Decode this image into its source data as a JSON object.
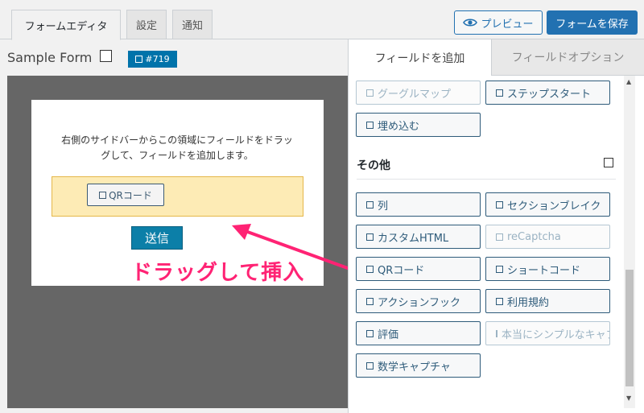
{
  "tabs": [
    {
      "label": "フォームエディタ"
    },
    {
      "label": "設定"
    },
    {
      "label": "通知"
    }
  ],
  "header": {
    "preview_label": "プレビュー",
    "save_label": "フォームを保存"
  },
  "form": {
    "title": "Sample Form",
    "id_badge": "#719"
  },
  "canvas": {
    "instruction_line1": "右側のサイドバーからこの領域にフィールドをドラッ",
    "instruction_line2": "グして、フィールドを追加します。",
    "dropped_field": "QRコード",
    "submit_label": "送信"
  },
  "annotation": {
    "text": "ドラッグして挿入",
    "color": "#ff2374"
  },
  "sidebar": {
    "tab_add": "フィールドを追加",
    "tab_options": "フィールドオプション",
    "top_fields": [
      {
        "label": "グーグルマップ",
        "disabled": true
      },
      {
        "label": "ステップスタート",
        "disabled": false
      },
      {
        "label": "埋め込む",
        "disabled": false
      }
    ],
    "section_title": "その他",
    "other_fields": [
      {
        "label": "列",
        "disabled": false
      },
      {
        "label": "セクションブレイク",
        "disabled": false
      },
      {
        "label": "カスタムHTML",
        "disabled": false
      },
      {
        "label": "reCaptcha",
        "disabled": true
      },
      {
        "label": "QRコード",
        "disabled": false
      },
      {
        "label": "ショートコード",
        "disabled": false
      },
      {
        "label": "アクションフック",
        "disabled": false
      },
      {
        "label": "利用規約",
        "disabled": false
      },
      {
        "label": "評価",
        "disabled": false
      },
      {
        "label": "本当にシンプルなキャプチャ",
        "disabled": true
      },
      {
        "label": "数学キャプチャ",
        "disabled": false
      }
    ]
  },
  "colors": {
    "primary": "#2271b1",
    "badge": "#0073aa",
    "drop_zone": "#fdebb5",
    "canvas_bg": "#666666"
  }
}
